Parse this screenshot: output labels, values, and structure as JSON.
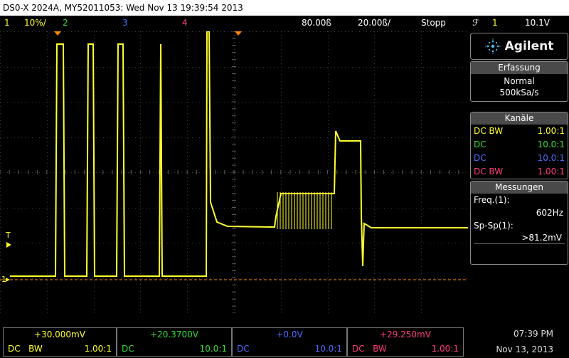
{
  "title": "DS0-X 2024A, MY52011053: Wed Nov 13 19:39:54 2013",
  "topbar": {
    "ch1_num": "1",
    "ch1_scale": "10%/",
    "ch2_num": "2",
    "ch3_num": "3",
    "ch4_num": "4",
    "time_ref": "80.00ß",
    "time_scale": "20.00ß/",
    "run_state": "Stopp",
    "trig_icon": "ℱ",
    "trig_ch": "1",
    "trig_level": "10.1V"
  },
  "markers": {
    "trigger_label": "T",
    "ground_label": "1"
  },
  "panel": {
    "brand": "Agilent",
    "brand_icon": "spark-icon",
    "acq_header": "Erfassung",
    "acq_mode": "Normal",
    "acq_rate": "500kSa/s",
    "channels_header": "Kanäle",
    "channels": [
      {
        "coupling": "DC BW",
        "probe": "1.00:1",
        "color": "#ffff2e"
      },
      {
        "coupling": "DC",
        "probe": "10.0:1",
        "color": "#33dd33"
      },
      {
        "coupling": "DC",
        "probe": "10.0:1",
        "color": "#4a6cff"
      },
      {
        "coupling": "DC BW",
        "probe": "1.00:1",
        "color": "#ff3a80"
      }
    ],
    "meas_header": "Messungen",
    "freq_label": "Freq.(1):",
    "freq_value": "602Hz",
    "spsp_label": "Sp-Sp(1):",
    "spsp_value": ">81.2mV"
  },
  "bottombar": {
    "ch1": {
      "offset": "+30.000mV",
      "coupling": "DC",
      "bw": "BW",
      "probe": "1.00:1"
    },
    "ch2": {
      "offset": "+20.3700V",
      "coupling": "DC",
      "probe": "10.0:1"
    },
    "ch3": {
      "offset": "+0.0V",
      "coupling": "DC",
      "probe": "10.0:1"
    },
    "ch4": {
      "offset": "+29.250mV",
      "coupling": "DC",
      "bw": "BW",
      "probe": "1.00:1"
    },
    "time": "07:39 PM",
    "date": "Nov 13, 2013"
  },
  "colors": {
    "ch1": "#ffff2e",
    "ch2": "#33dd33",
    "ch3": "#4a6cff",
    "ch4": "#ff3a80",
    "trigger_marker": "#ff8800"
  }
}
